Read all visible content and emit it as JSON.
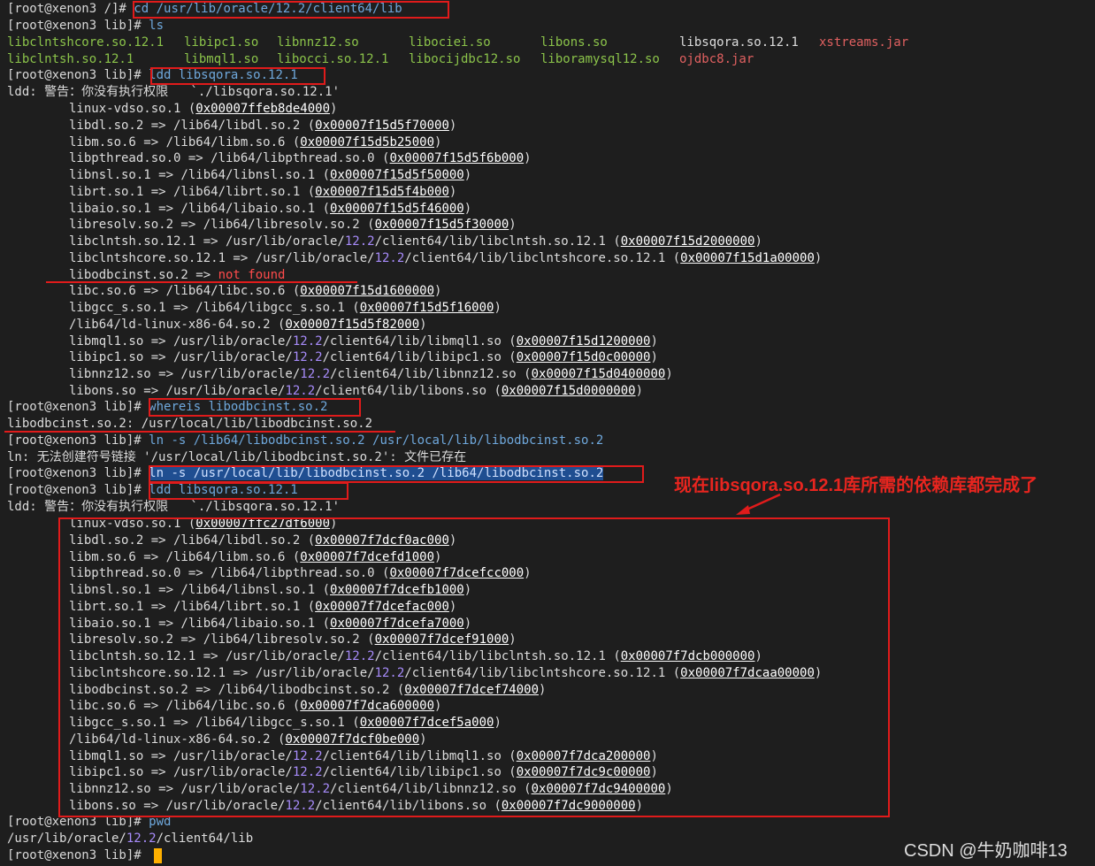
{
  "prompt_root": "[root@xenon3 /]# ",
  "prompt_lib": "[root@xenon3 lib]# ",
  "cmd_cd": "cd /usr/lib/oracle/12.2/client64/lib",
  "cmd_ls": "ls",
  "ls_files": [
    [
      "libclntshcore.so.12.1",
      "libclntsh.so.12.1"
    ],
    [
      "libipc1.so",
      "libmql1.so"
    ],
    [
      "libnnz12.so",
      "libocci.so.12.1"
    ],
    [
      "libociei.so",
      "libocijdbc12.so"
    ],
    [
      "libons.so",
      "liboramysql12.so"
    ],
    [
      "libsqora.so.12.1",
      "ojdbc8.jar"
    ],
    [
      "xstreams.jar",
      ""
    ]
  ],
  "cmd_ldd": "ldd libsqora.so.12.1",
  "ldd_warning": "ldd: 警告：你没有执行权限   `./libsqora.so.12.1'",
  "ldd1": [
    {
      "pre": "linux-vdso.so.1 (",
      "addr": "0x00007ffeb8de4000",
      "post": ")"
    },
    {
      "pre": "libdl.so.2 => /lib64/libdl.so.2 (",
      "addr": "0x00007f15d5f70000",
      "post": ")"
    },
    {
      "pre": "libm.so.6 => /lib64/libm.so.6 (",
      "addr": "0x00007f15d5b25000",
      "post": ")"
    },
    {
      "pre": "libpthread.so.0 => /lib64/libpthread.so.0 (",
      "addr": "0x00007f15d5f6b000",
      "post": ")"
    },
    {
      "pre": "libnsl.so.1 => /lib64/libnsl.so.1 (",
      "addr": "0x00007f15d5f50000",
      "post": ")"
    },
    {
      "pre": "librt.so.1 => /lib64/librt.so.1 (",
      "addr": "0x00007f15d5f4b000",
      "post": ")"
    },
    {
      "pre": "libaio.so.1 => /lib64/libaio.so.1 (",
      "addr": "0x00007f15d5f46000",
      "post": ")"
    },
    {
      "pre": "libresolv.so.2 => /lib64/libresolv.so.2 (",
      "addr": "0x00007f15d5f30000",
      "post": ")"
    },
    {
      "pre": "libclntsh.so.12.1 => /usr/lib/oracle/",
      "ver": "12.2",
      "mid": "/client64/lib/libclntsh.so.12.1 (",
      "addr": "0x00007f15d2000000",
      "post": ")"
    },
    {
      "pre": "libclntshcore.so.12.1 => /usr/lib/oracle/",
      "ver": "12.2",
      "mid": "/client64/lib/libclntshcore.so.12.1 (",
      "addr": "0x00007f15d1a00000",
      "post": ")"
    },
    {
      "pre": "libodbcinst.so.2 => ",
      "nf": "not found"
    },
    {
      "pre": "libc.so.6 => /lib64/libc.so.6 (",
      "addr": "0x00007f15d1600000",
      "post": ")"
    },
    {
      "pre": "libgcc_s.so.1 => /lib64/libgcc_s.so.1 (",
      "addr": "0x00007f15d5f16000",
      "post": ")"
    },
    {
      "pre": "/lib64/ld-linux-x86-64.so.2 (",
      "addr": "0x00007f15d5f82000",
      "post": ")"
    },
    {
      "pre": "libmql1.so => /usr/lib/oracle/",
      "ver": "12.2",
      "mid": "/client64/lib/libmql1.so (",
      "addr": "0x00007f15d1200000",
      "post": ")"
    },
    {
      "pre": "libipc1.so => /usr/lib/oracle/",
      "ver": "12.2",
      "mid": "/client64/lib/libipc1.so (",
      "addr": "0x00007f15d0c00000",
      "post": ")"
    },
    {
      "pre": "libnnz12.so => /usr/lib/oracle/",
      "ver": "12.2",
      "mid": "/client64/lib/libnnz12.so (",
      "addr": "0x00007f15d0400000",
      "post": ")"
    },
    {
      "pre": "libons.so => /usr/lib/oracle/",
      "ver": "12.2",
      "mid": "/client64/lib/libons.so (",
      "addr": "0x00007f15d0000000",
      "post": ")"
    }
  ],
  "cmd_whereis": "whereis libodbcinst.so.2",
  "whereis_out": "libodbcinst.so.2: /usr/local/lib/libodbcinst.so.2",
  "cmd_ln1": "ln -s /lib64/libodbcinst.so.2 /usr/local/lib/libodbcinst.so.2",
  "ln_error": "ln: 无法创建符号链接 '/usr/local/lib/libodbcinst.so.2': 文件已存在",
  "cmd_ln2": "ln -s /usr/local/lib/libodbcinst.so.2 /lib64/libodbcinst.so.2",
  "ldd2": [
    {
      "pre": "linux-vdso.so.1 (",
      "addr": "0x00007ffc27df6000",
      "post": ")"
    },
    {
      "pre": "libdl.so.2 => /lib64/libdl.so.2 (",
      "addr": "0x00007f7dcf0ac000",
      "post": ")"
    },
    {
      "pre": "libm.so.6 => /lib64/libm.so.6 (",
      "addr": "0x00007f7dcefd1000",
      "post": ")"
    },
    {
      "pre": "libpthread.so.0 => /lib64/libpthread.so.0 (",
      "addr": "0x00007f7dcefcc000",
      "post": ")"
    },
    {
      "pre": "libnsl.so.1 => /lib64/libnsl.so.1 (",
      "addr": "0x00007f7dcefb1000",
      "post": ")"
    },
    {
      "pre": "librt.so.1 => /lib64/librt.so.1 (",
      "addr": "0x00007f7dcefac000",
      "post": ")"
    },
    {
      "pre": "libaio.so.1 => /lib64/libaio.so.1 (",
      "addr": "0x00007f7dcefa7000",
      "post": ")"
    },
    {
      "pre": "libresolv.so.2 => /lib64/libresolv.so.2 (",
      "addr": "0x00007f7dcef91000",
      "post": ")"
    },
    {
      "pre": "libclntsh.so.12.1 => /usr/lib/oracle/",
      "ver": "12.2",
      "mid": "/client64/lib/libclntsh.so.12.1 (",
      "addr": "0x00007f7dcb000000",
      "post": ")"
    },
    {
      "pre": "libclntshcore.so.12.1 => /usr/lib/oracle/",
      "ver": "12.2",
      "mid": "/client64/lib/libclntshcore.so.12.1 (",
      "addr": "0x00007f7dcaa00000",
      "post": ")"
    },
    {
      "pre": "libodbcinst.so.2 => /lib64/libodbcinst.so.2 (",
      "addr": "0x00007f7dcef74000",
      "post": ")"
    },
    {
      "pre": "libc.so.6 => /lib64/libc.so.6 (",
      "addr": "0x00007f7dca600000",
      "post": ")"
    },
    {
      "pre": "libgcc_s.so.1 => /lib64/libgcc_s.so.1 (",
      "addr": "0x00007f7dcef5a000",
      "post": ")"
    },
    {
      "pre": "/lib64/ld-linux-x86-64.so.2 (",
      "addr": "0x00007f7dcf0be000",
      "post": ")"
    },
    {
      "pre": "libmql1.so => /usr/lib/oracle/",
      "ver": "12.2",
      "mid": "/client64/lib/libmql1.so (",
      "addr": "0x00007f7dca200000",
      "post": ")"
    },
    {
      "pre": "libipc1.so => /usr/lib/oracle/",
      "ver": "12.2",
      "mid": "/client64/lib/libipc1.so (",
      "addr": "0x00007f7dc9c00000",
      "post": ")"
    },
    {
      "pre": "libnnz12.so => /usr/lib/oracle/",
      "ver": "12.2",
      "mid": "/client64/lib/libnnz12.so (",
      "addr": "0x00007f7dc9400000",
      "post": ")"
    },
    {
      "pre": "libons.so => /usr/lib/oracle/",
      "ver": "12.2",
      "mid": "/client64/lib/libons.so (",
      "addr": "0x00007f7dc9000000",
      "post": ")"
    }
  ],
  "cmd_pwd": "pwd",
  "pwd_pre": "/usr/lib/oracle/",
  "pwd_ver": "12.2",
  "pwd_post": "/client64/lib",
  "annotation": "现在libsqora.so.12.1库所需的依赖库都完成了",
  "watermark": "CSDN @牛奶咖啡13",
  "colors": {
    "background": "#1e1e1e",
    "command": "#6fa8dc",
    "library": "#8bc34a",
    "jar": "#e06060",
    "version": "#a78bfa",
    "not_found": "#ff4b4b",
    "annotation_red": "#e01b1b",
    "cursor": "#ffb000"
  }
}
